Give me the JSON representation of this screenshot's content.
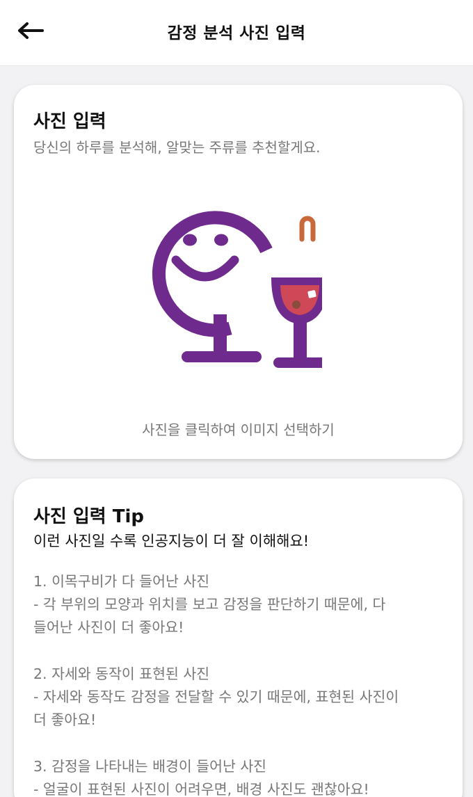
{
  "header": {
    "title": "감정 분석 사진 입력",
    "back_icon": "arrow-left-icon"
  },
  "photo_card": {
    "title": "사진 입력",
    "subtitle": "당신의 하루를 분석해, 알맞는 주류를 추천할게요.",
    "logo_icon": "smile-wine-glass-logo",
    "hint": "사진을 클릭하여 이미지 선택하기",
    "colors": {
      "purple": "#6e2a8c",
      "orange": "#c8693c",
      "wine": "#cf4858"
    }
  },
  "tip_card": {
    "title": "사진 입력 Tip",
    "lead": "이런 사진일 수록 인공지능이 더 잘 이해해요!",
    "tips": [
      {
        "heading": "1. 이목구비가 다 들어난 사진",
        "line1": "- 각 부위의 모양과 위치를 보고 감정을 판단하기 때문에, 다",
        "line2": "들어난 사진이 더 좋아요!"
      },
      {
        "heading": "2. 자세와 동작이 표현된 사진",
        "line1": "- 자세와 동작도 감정을 전달할 수 있기 때문에, 표현된 사진이",
        "line2": "더 좋아요!"
      },
      {
        "heading": "3. 감정을 나타내는 배경이 들어난 사진",
        "line1": "- 얼굴이 표현된 사진이 어려우면, 배경 사진도 괜찮아요!"
      }
    ]
  }
}
